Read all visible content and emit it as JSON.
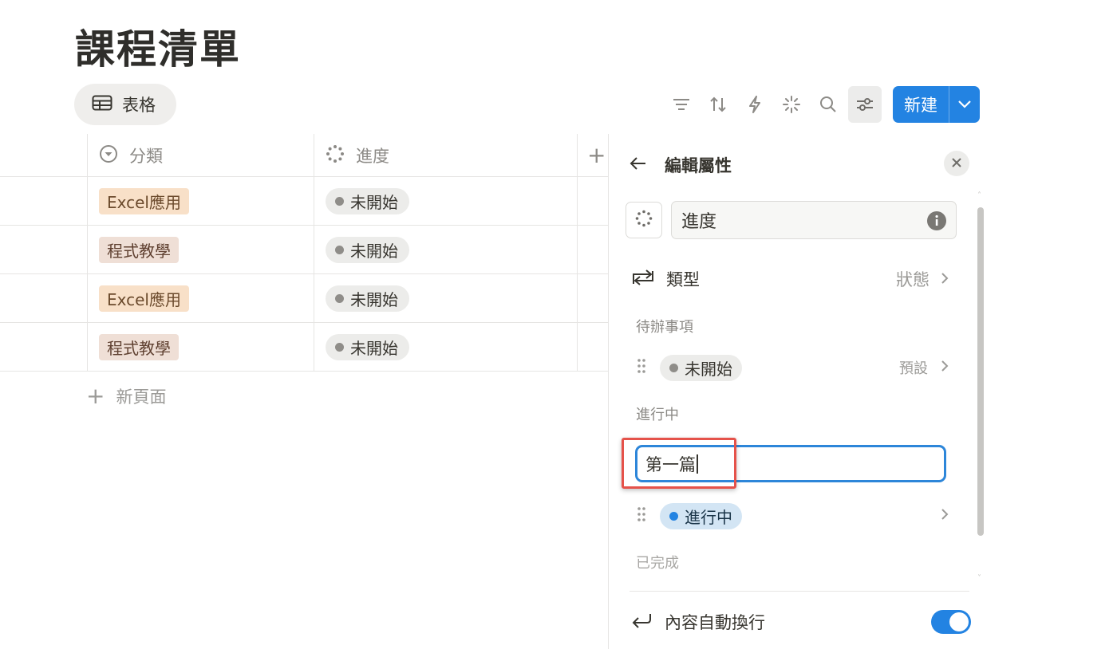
{
  "page": {
    "title": "課程清單"
  },
  "view": {
    "tab_label": "表格",
    "tab_icon": "table-icon"
  },
  "toolbar": {
    "icons": [
      "filter-icon",
      "sort-icon",
      "automation-icon",
      "ai-sparkle-icon",
      "search-icon",
      "settings-sliders-icon"
    ],
    "new_label": "新建",
    "accent": "#2383e2"
  },
  "table": {
    "columns": [
      {
        "label": "分類",
        "icon": "select-icon"
      },
      {
        "label": "進度",
        "icon": "status-icon"
      }
    ],
    "rows": [
      {
        "category": "Excel應用",
        "status": "未開始"
      },
      {
        "category": "程式教學",
        "status": "未開始"
      },
      {
        "category": "Excel應用",
        "status": "未開始"
      },
      {
        "category": "程式教學",
        "status": "未開始"
      }
    ],
    "new_page_label": "新頁面",
    "tag_colors": {
      "excel": "#f8e0c8",
      "prog": "#efdfd6"
    }
  },
  "panel": {
    "title": "編輯屬性",
    "property_name": "進度",
    "type_label": "類型",
    "type_value": "狀態",
    "groups": {
      "todo": "待辦事項",
      "in_progress": "進行中",
      "done": "已完成"
    },
    "options": {
      "not_started": {
        "label": "未開始",
        "note": "預設"
      },
      "in_progress": {
        "label": "進行中"
      }
    },
    "edit_input_value": "第一篇",
    "wrap_label": "內容自動換行",
    "wrap_enabled": true,
    "highlight_color": "#e5524a"
  }
}
